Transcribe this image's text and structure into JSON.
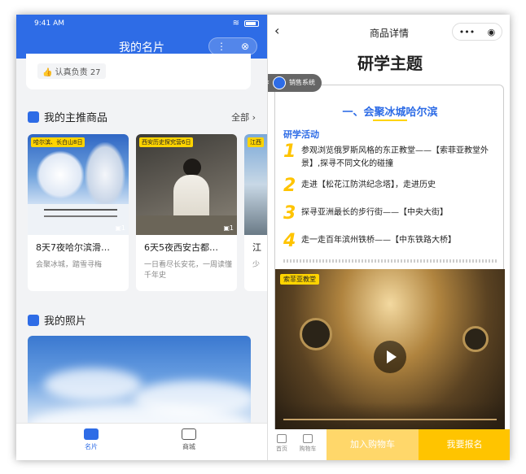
{
  "left": {
    "status_time": "9:41 AM",
    "title": "我的名片",
    "capsule": {
      "more": "⋮",
      "close": "⊗"
    },
    "like_label": "认真负责 27",
    "products_section": {
      "title": "我的主推商品",
      "all_label": "全部"
    },
    "products": [
      {
        "tag": "哈尔滨、长白山8日",
        "count": "1",
        "title": "8天7夜哈尔滨滑…",
        "subtitle": "会聚冰城，踏雪寻梅"
      },
      {
        "tag": "西安历史探究营6日",
        "count": "1",
        "title": "6天5夜西安古都…",
        "subtitle": "一日看尽长安花，一周读懂千年史"
      },
      {
        "tag": "江西",
        "count": "",
        "title": "江",
        "subtitle": "少"
      }
    ],
    "photos_section": {
      "title": "我的照片"
    },
    "tabs": [
      {
        "label": "名片"
      },
      {
        "label": "商城"
      }
    ]
  },
  "right": {
    "nav_title": "商品详情",
    "capsule": {
      "more": "•••",
      "record": "◉"
    },
    "headline": "研学主题",
    "sales_label": "销售系统",
    "section_title": "一、会聚冰城哈尔滨",
    "activity_label": "研学活动",
    "items": [
      {
        "num": "1",
        "text": "参观浏览俄罗斯风格的东正教堂——【索菲亚教堂外景】,探寻不同文化的碰撞"
      },
      {
        "num": "2",
        "text": "走进【松花江防洪纪念塔】，走进历史"
      },
      {
        "num": "3",
        "text": "探寻亚洲最长的步行街——【中央大街】"
      },
      {
        "num": "4",
        "text": "走一走百年滨州铁桥——【中东铁路大桥】"
      }
    ],
    "video_tag": "索菲亚教堂",
    "bottom": {
      "home_label": "首页",
      "cart_label": "购物车",
      "add_cart": "加入购物车",
      "signup": "我要报名"
    }
  },
  "colors": {
    "primary": "#2e6ce6",
    "accent": "#ffc400"
  }
}
